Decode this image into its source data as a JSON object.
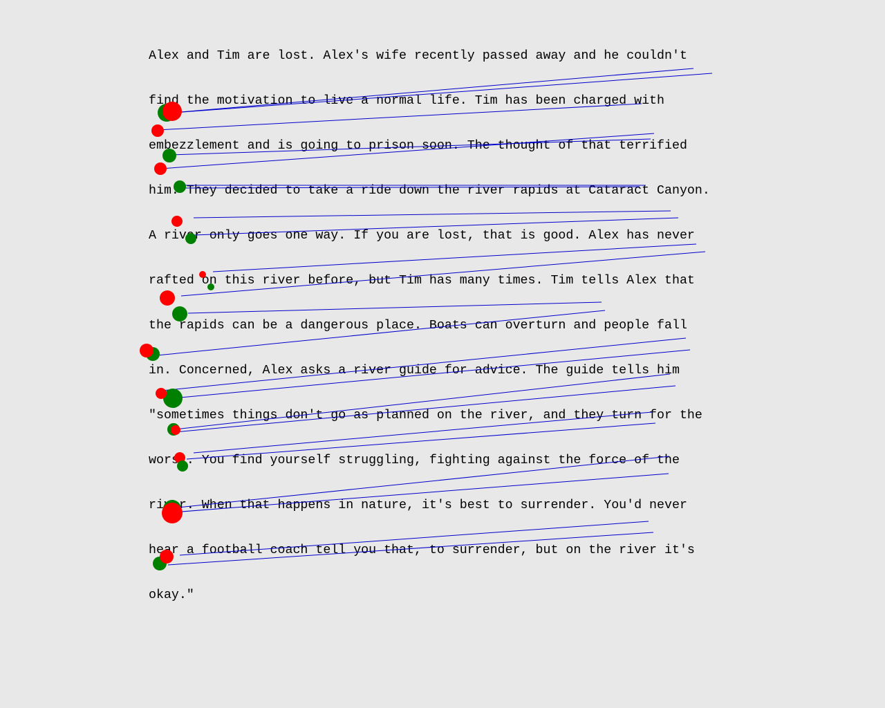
{
  "passage": {
    "lines": [
      "Alex and Tim are lost. Alex's wife recently passed away and he couldn't",
      "find the motivation to live a normal life. Tim has been charged with",
      "embezzlement and is going to prison soon. The thought of that terrified",
      "him. They decided to take a ride down the river rapids at Cataract Canyon.",
      "A river only goes one way. If you are lost, that is good. Alex has never",
      "rafted on this river before, but Tim has many times. Tim tells Alex that",
      "the rapids can be a dangerous place. Boats can overturn and people fall",
      "in. Concerned, Alex asks a river guide for advice. The guide tells him",
      "\"sometimes things don't go as planned on the river, and they turn for the",
      "worst. You find yourself struggling, fighting against the force of the",
      "river. When that happens in nature, it's best to surrender. You'd never",
      "hear a football coach tell you that, to surrender, but on the river it's",
      "okay.\""
    ]
  },
  "gaze_overlay": {
    "colors": {
      "background": "#e8e8e8",
      "text": "#000000",
      "eye_a_fixation": "#ff0000",
      "eye_b_fixation": "#008000",
      "saccade": "#0000cc"
    }
  }
}
